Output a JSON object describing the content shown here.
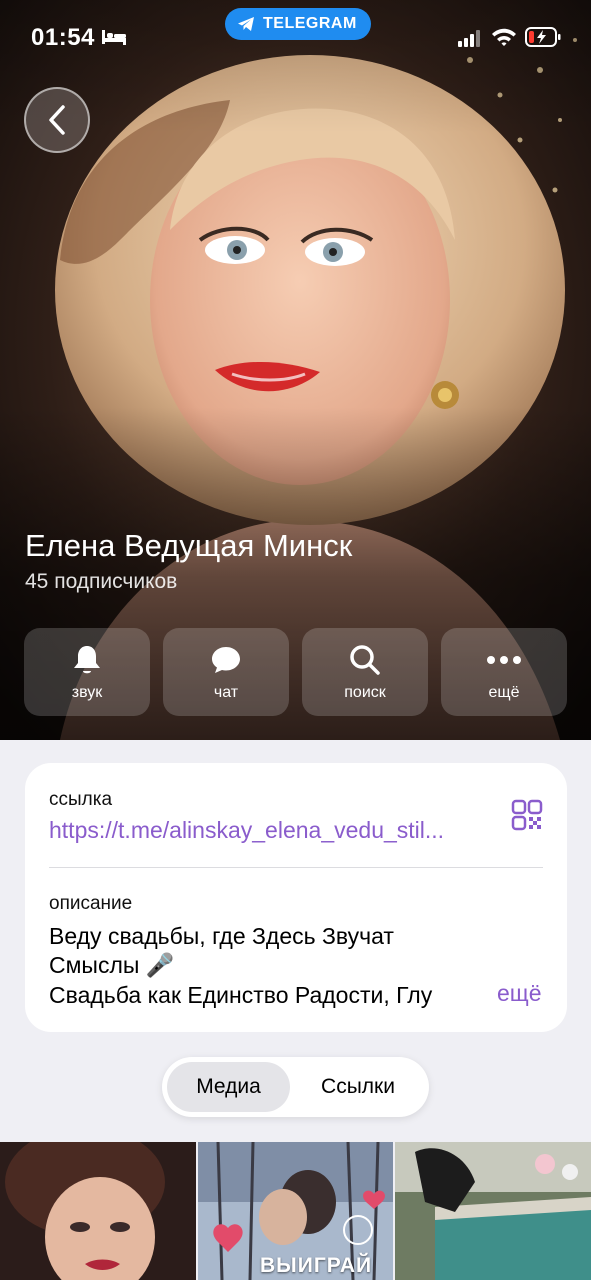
{
  "status_bar": {
    "time": "01:54",
    "icons": [
      "bed-icon",
      "cellular-signal-icon",
      "wifi-icon",
      "battery-charging-icon"
    ]
  },
  "source_pill": {
    "label": "TELEGRAM",
    "icon": "telegram-plane-icon",
    "color": "#1f8cf0"
  },
  "header": {
    "back_icon": "chevron-left-icon",
    "channel_name": "Елена Ведущая Минск",
    "subscribers": "45 подписчиков"
  },
  "actions": [
    {
      "id": "sound",
      "label": "звук",
      "icon": "bell-icon"
    },
    {
      "id": "chat",
      "label": "чат",
      "icon": "chat-bubble-icon"
    },
    {
      "id": "search",
      "label": "поиск",
      "icon": "search-icon"
    },
    {
      "id": "more",
      "label": "ещё",
      "icon": "more-dots-icon"
    }
  ],
  "info": {
    "link_label": "ссылка",
    "link_value": "https://t.me/alinskay_elena_vedu_stil...",
    "qr_icon": "qr-code-icon",
    "description_label": "описание",
    "description_lines": [
      "Веду свадьбы, где Здесь Звучат",
      "Смыслы 🎤",
      "Свадьба как Единство Радости, Глу"
    ],
    "more_label": "ещё"
  },
  "tabs": {
    "items": [
      "Медиа",
      "Ссылки"
    ],
    "selected": "Медиа"
  },
  "media": {
    "tile_2_caption": "ВЫИГРАЙ"
  },
  "colors": {
    "accent": "#8a5ccc",
    "telegram_blue": "#1f8cf0",
    "background": "#efeff4"
  }
}
